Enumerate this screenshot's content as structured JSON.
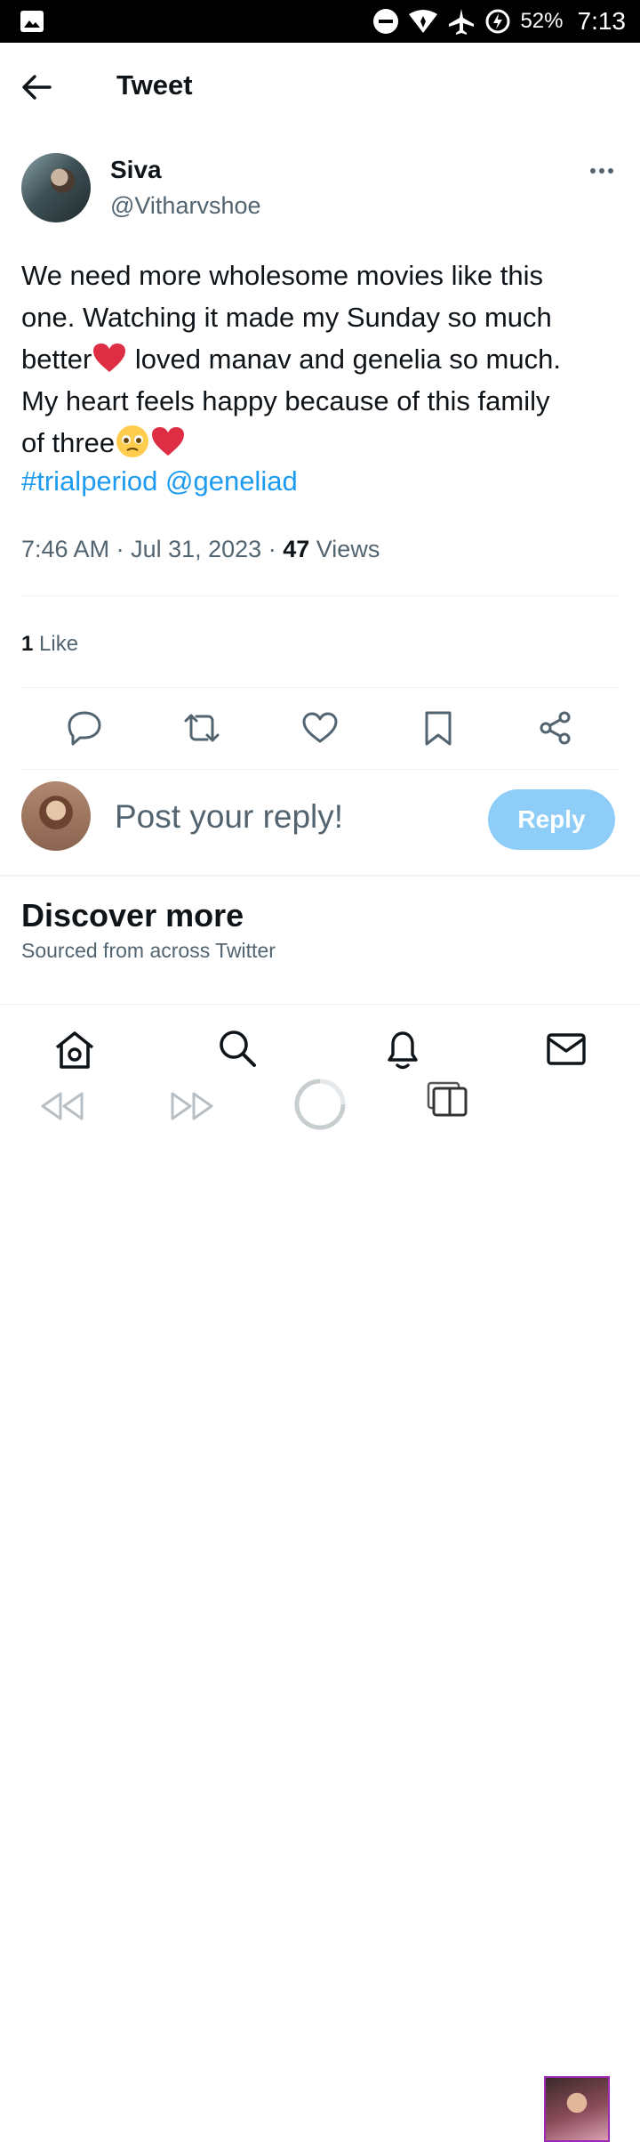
{
  "status_bar": {
    "battery_percent": "52%",
    "time": "7:13",
    "icons": [
      "image-icon",
      "do-not-disturb-icon",
      "wifi-icon",
      "airplane-icon",
      "battery-charging-icon"
    ]
  },
  "header": {
    "title": "Tweet"
  },
  "tweet": {
    "author_name": "Siva",
    "author_handle": "@Vitharvshoe",
    "text_line1": "We need more wholesome movies like this",
    "text_line2": "one. Watching it made my Sunday so much",
    "text_line3a": "better",
    "text_line3b": " loved manav and genelia so much.",
    "text_line4": "My heart feels happy because of this family",
    "text_line5": "of three",
    "hashtag": "#trialperiod",
    "mention": "@geneliad",
    "time": "7:46 AM",
    "date": "Jul 31, 2023",
    "views_count": "47",
    "views_label": "Views",
    "likes_count": "1",
    "likes_label": "Like"
  },
  "reply": {
    "placeholder": "Post your reply!",
    "button_label": "Reply"
  },
  "discover": {
    "title": "Discover more",
    "subtitle": "Sourced from across Twitter"
  },
  "colors": {
    "accent": "#1d9bf0",
    "reply_button_disabled": "#8ecdf7",
    "secondary_text": "#536471",
    "heart": "#e0245e"
  }
}
